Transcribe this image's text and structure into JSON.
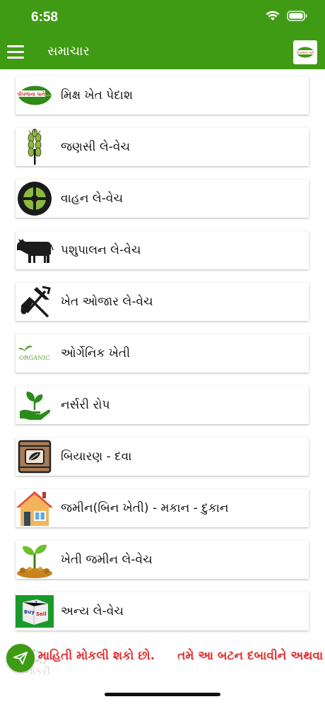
{
  "status": {
    "time": "6:58"
  },
  "header": {
    "title": "સમાચાર",
    "logo_text": "પીપળાના પાને"
  },
  "items": [
    {
      "label": "મિક્ષ ખેત પેદાશ",
      "icon": "leaf-logo-icon"
    },
    {
      "label": "જણસી લે-વેચ",
      "icon": "wheat-icon"
    },
    {
      "label": "વાહન લે-વેચ",
      "icon": "tire-icon"
    },
    {
      "label": "પશુપાલન લે-વેચ",
      "icon": "cow-icon"
    },
    {
      "label": "ખેત ઓજાર લે-વેચ",
      "icon": "tools-icon"
    },
    {
      "label": "ઓર્ગેનિક ખેતી",
      "icon": "organic-icon"
    },
    {
      "label": "નર્સરી રોપ",
      "icon": "seedling-hand-icon"
    },
    {
      "label": "બિયારણ - દવા",
      "icon": "seed-bag-icon"
    },
    {
      "label": "જમીન(બિન ખેતી) - મકાન - દુકાન",
      "icon": "house-icon"
    },
    {
      "label": "ખેતી જમીન લે-વેચ",
      "icon": "plant-soil-icon"
    },
    {
      "label": "અન્ય લે-વેચ",
      "icon": "buy-sell-dice-icon"
    }
  ],
  "organic_text": "ORGANIC",
  "dice": {
    "buy": "Buy",
    "sell": "Sell"
  },
  "ticker": {
    "part1": "માહિતી મોકલી શકો છો.",
    "part2": "તમે આ બટન દબાવીને અથવા"
  },
  "faded_tab_label": "નોકરી",
  "colors": {
    "brand_green": "#3f9a14",
    "ticker_red": "#e03030"
  }
}
